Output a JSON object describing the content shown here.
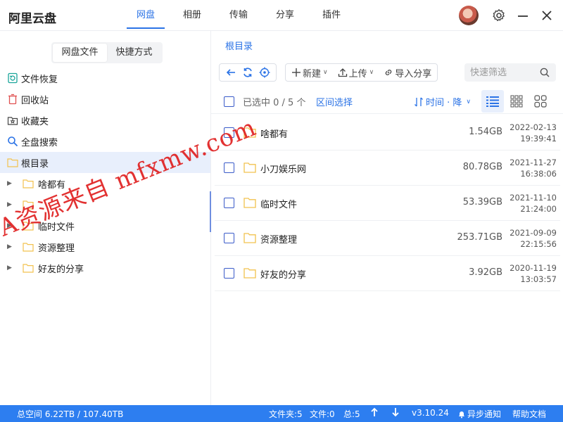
{
  "app": {
    "title": "阿里云盘"
  },
  "nav": {
    "tabs": [
      {
        "label": "网盘",
        "active": true
      },
      {
        "label": "相册"
      },
      {
        "label": "传输"
      },
      {
        "label": "分享"
      },
      {
        "label": "插件"
      }
    ]
  },
  "sidebar": {
    "segments": [
      {
        "label": "网盘文件",
        "active": true
      },
      {
        "label": "快捷方式"
      }
    ],
    "menu": [
      {
        "label": "文件恢复",
        "icon": "file-restore-icon"
      },
      {
        "label": "回收站",
        "icon": "trash-icon"
      },
      {
        "label": "收藏夹",
        "icon": "star-folder-icon"
      },
      {
        "label": "全盘搜索",
        "icon": "search-icon"
      },
      {
        "label": "根目录",
        "icon": "folder-icon",
        "selected": true
      }
    ],
    "tree": [
      {
        "label": "啥都有"
      },
      {
        "label": ""
      },
      {
        "label": "临时文件"
      },
      {
        "label": "资源整理"
      },
      {
        "label": "好友的分享"
      }
    ]
  },
  "main": {
    "breadcrumb": "根目录",
    "toolbar": {
      "new_label": "新建",
      "upload_label": "上传",
      "import_share_label": "导入分享",
      "filter_placeholder": "快速筛选"
    },
    "list_header": {
      "selected_text": "已选中 0 / 5 个",
      "range_select": "区间选择",
      "sort_label": "时间 · 降"
    },
    "files": [
      {
        "name": "啥都有",
        "size": "1.54GB",
        "date": "2022-02-13",
        "time": "19:39:41"
      },
      {
        "name": "小刀娱乐网",
        "size": "80.78GB",
        "date": "2021-11-27",
        "time": "16:38:06"
      },
      {
        "name": "临时文件",
        "size": "53.39GB",
        "date": "2021-11-10",
        "time": "21:24:00"
      },
      {
        "name": "资源整理",
        "size": "253.71GB",
        "date": "2021-09-09",
        "time": "22:15:56"
      },
      {
        "name": "好友的分享",
        "size": "3.92GB",
        "date": "2020-11-19",
        "time": "13:03:57"
      }
    ]
  },
  "statusbar": {
    "total_space": "总空间 6.22TB / 107.40TB",
    "folders": "文件夹:5",
    "files": "文件:0",
    "total": "总:5",
    "version": "v3.10.24",
    "async_notify": "异步通知",
    "help": "帮助文档"
  },
  "watermark": "A资源来自 mfxmw.com",
  "colors": {
    "accent": "#2b73e6",
    "statusbar": "#2d7ef0",
    "folder": "#f2c24f",
    "watermark": "#e02020"
  }
}
